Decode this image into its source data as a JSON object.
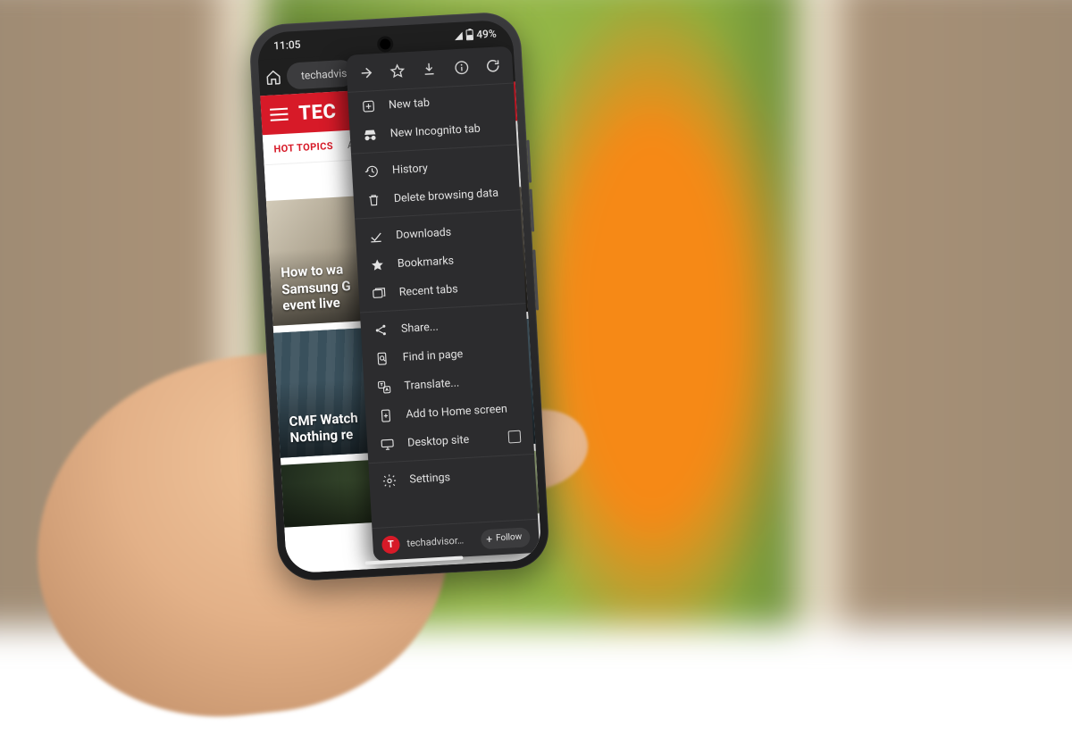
{
  "status": {
    "time": "11:05",
    "battery": "49%"
  },
  "toolbar": {
    "url_text": "techadvis"
  },
  "site": {
    "brand": "TEC",
    "hot_label": "HOT TOPICS",
    "hot_items": [
      "Amaz"
    ]
  },
  "cards": [
    {
      "title": "How to wa\nSamsung G\nevent live"
    },
    {
      "title": "CMF Watch\nNothing re"
    },
    {
      "title": ""
    }
  ],
  "menu": {
    "icon_row": [
      "forward",
      "star",
      "download",
      "info",
      "refresh"
    ],
    "groups": [
      [
        {
          "icon": "plus-box",
          "label": "New tab"
        },
        {
          "icon": "incognito",
          "label": "New Incognito tab"
        }
      ],
      [
        {
          "icon": "history",
          "label": "History"
        },
        {
          "icon": "trash",
          "label": "Delete browsing data"
        }
      ],
      [
        {
          "icon": "download",
          "label": "Downloads"
        },
        {
          "icon": "star",
          "label": "Bookmarks"
        },
        {
          "icon": "tabs",
          "label": "Recent tabs"
        }
      ],
      [
        {
          "icon": "share",
          "label": "Share..."
        },
        {
          "icon": "find",
          "label": "Find in page"
        },
        {
          "icon": "translate",
          "label": "Translate..."
        },
        {
          "icon": "add-home",
          "label": "Add to Home screen"
        },
        {
          "icon": "desktop",
          "label": "Desktop site",
          "trailing_checkbox": true
        }
      ],
      [
        {
          "icon": "gear",
          "label": "Settings"
        }
      ]
    ],
    "footer": {
      "favicon_letter": "T",
      "site_label": "techadvisor…",
      "follow_label": "Follow"
    }
  }
}
